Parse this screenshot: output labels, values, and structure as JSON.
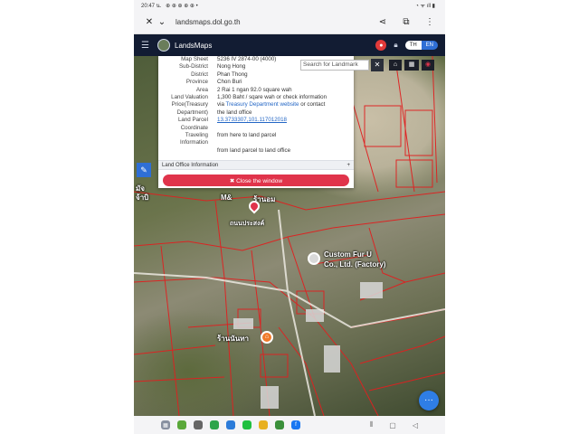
{
  "status_bar": {
    "time": "20:47 น.",
    "left_icons": "⊕ ⊕ ⊕ ⊕ ⊕ •",
    "right_icons": "◔ ᯤ ıll ▮"
  },
  "browser": {
    "url": "landsmaps.dol.go.th"
  },
  "app": {
    "title": "LandsMaps",
    "lang_th": "TH",
    "lang_en": "EN"
  },
  "info": {
    "rows": [
      {
        "label": "Map Sheet",
        "value": "5236 IV 2874-00 (4000)"
      },
      {
        "label": "Sub-District",
        "value": "Nong Hong"
      },
      {
        "label": "District",
        "value": "Phan Thong"
      },
      {
        "label": "Province",
        "value": "Chon Buri"
      },
      {
        "label": "Area",
        "value": "2 Rai 1 ngan 92.0 square wah"
      },
      {
        "label": "Land Valuation",
        "value": "1,300 Baht / sqare wah or check information"
      }
    ],
    "price_label_1": "Price(Treasury",
    "price_label_2": "Department)",
    "price_value_1": "via ",
    "price_link": "Treasury Department website",
    "price_value_1b": " or contact",
    "price_value_2": "the land office",
    "parcel_label": "Land Parcel",
    "parcel_value": "13.3733307,101.117012018",
    "coordinate_label": "Coordinate",
    "travel_label": "Traveling Information",
    "travel_1": "from here to land parcel",
    "travel_2": "from land parcel to land office",
    "land_office_label": "Land Office Information",
    "land_office_plus": "+",
    "close_label": "✖ Close the window"
  },
  "map": {
    "search_placeholder": "Search for Landmark",
    "search_close": "✕",
    "labels": {
      "shop_1": "M&",
      "shop_1b": "ร้านอม",
      "road_1": "ถนนประสงค์",
      "factory_1": "Custom Fur U",
      "factory_2": "Co., Ltd. (Factory)",
      "shop_2": "ร้านนันทา",
      "left_1": "มัจ",
      "left_2": "จ้าบิ"
    }
  },
  "colors": {
    "header_bg": "#121c33",
    "accent_blue": "#2f6fd6",
    "close_red": "#e0344b",
    "parcel_line": "#e02020"
  }
}
